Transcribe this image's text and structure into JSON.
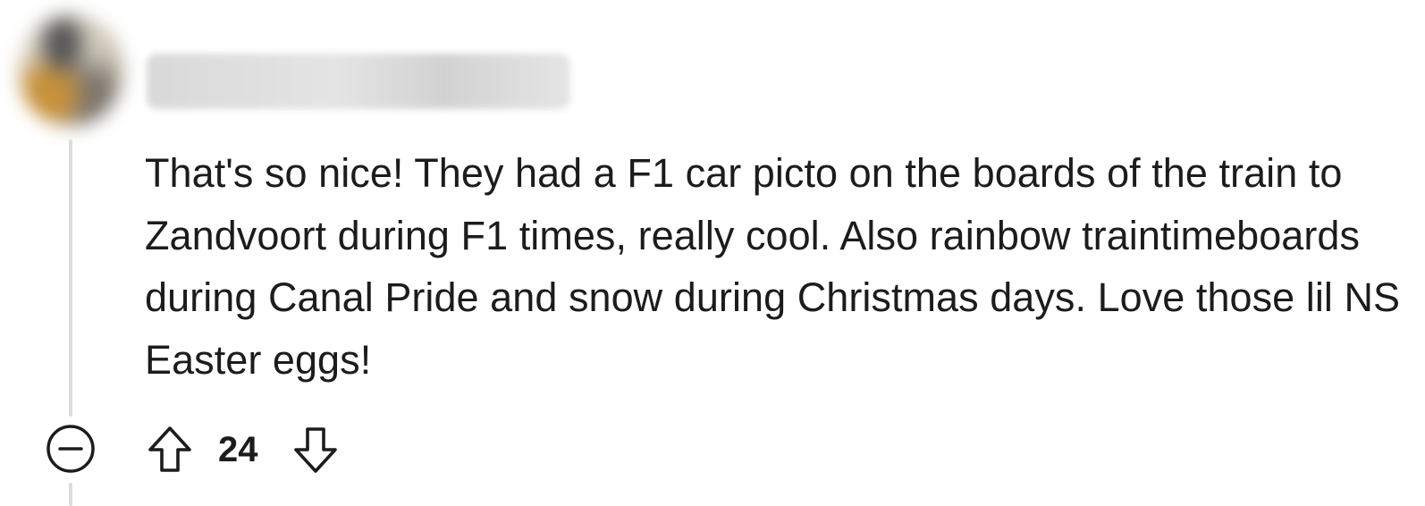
{
  "comment": {
    "username": "",
    "body": "That's so nice! They had a F1 car picto on the boards of the train to Zandvoort during F1 times, really cool. Also rainbow traintimeboards during Canal Pride and snow during Christmas days. Love those lil NS Easter eggs!",
    "score": "24",
    "icons": {
      "collapse": "collapse-minus-icon",
      "upvote": "up-arrow-icon",
      "downvote": "down-arrow-icon"
    }
  }
}
